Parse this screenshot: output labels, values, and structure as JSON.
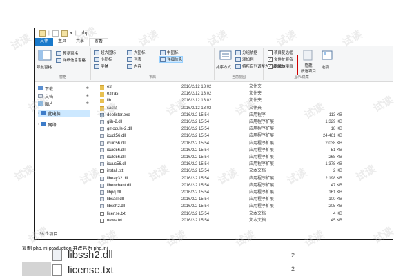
{
  "window": {
    "title": "php",
    "tabs": [
      "文件",
      "主页",
      "共享",
      "查看"
    ]
  },
  "ribbon": {
    "pane_group": {
      "nav_pane": "导航窗格",
      "preview_pane": "预览窗格",
      "details_pane": "详细信息窗格",
      "title": "窗格"
    },
    "layout_group": {
      "extra_large_icons": "超大图标",
      "large_icons": "大图标",
      "medium_icons": "中图标",
      "small_icons": "小图标",
      "list": "列表",
      "details": "详细信息",
      "tiles": "平铺",
      "content": "内容",
      "title": "布局"
    },
    "current_view_group": {
      "sort_by": "排序方式",
      "group_by": "分组依据",
      "add_columns": "添加列",
      "size_all_columns": "将所有列调整为合适的大小",
      "title": "当前视图"
    },
    "show_hide_group": {
      "item_checkboxes": "项目复选框",
      "file_extensions": "文件扩展名",
      "hidden_items": "隐藏的项目",
      "hide_selected": "隐藏",
      "hide_selected_2": "所选项目",
      "options": "选项",
      "title": "显示/隐藏",
      "item_checkboxes_checked": false,
      "file_extensions_checked": true,
      "hidden_items_checked": true
    }
  },
  "nav": {
    "items": [
      {
        "label": "下载",
        "icon": "download-icon",
        "pinned": true
      },
      {
        "label": "文档",
        "icon": "documents-icon",
        "pinned": true
      },
      {
        "label": "图片",
        "icon": "pictures-icon",
        "pinned": true
      },
      {
        "label": "此电脑",
        "icon": "computer-icon",
        "pinned": false
      },
      {
        "label": "网络",
        "icon": "network-icon",
        "pinned": false
      }
    ]
  },
  "files": [
    {
      "name": "ext",
      "date": "2016/2/12 13:02",
      "type": "文件夹",
      "size": "",
      "kind": "folder"
    },
    {
      "name": "extras",
      "date": "2016/2/12 13:02",
      "type": "文件夹",
      "size": "",
      "kind": "folder"
    },
    {
      "name": "lib",
      "date": "2016/2/12 13:02",
      "type": "文件夹",
      "size": "",
      "kind": "folder"
    },
    {
      "name": "sasl2",
      "date": "2016/2/12 13:02",
      "type": "文件夹",
      "size": "",
      "kind": "folder"
    },
    {
      "name": "deplister.exe",
      "date": "2016/2/2 15:54",
      "type": "应用程序",
      "size": "113 KB",
      "kind": "exe"
    },
    {
      "name": "glib-2.dll",
      "date": "2016/2/2 15:54",
      "type": "应用程序扩展",
      "size": "1,329 KB",
      "kind": "dll"
    },
    {
      "name": "gmodule-2.dll",
      "date": "2016/2/2 15:54",
      "type": "应用程序扩展",
      "size": "18 KB",
      "kind": "dll"
    },
    {
      "name": "icudt56.dll",
      "date": "2016/2/2 15:54",
      "type": "应用程序扩展",
      "size": "24,461 KB",
      "kind": "dll"
    },
    {
      "name": "icuin56.dll",
      "date": "2016/2/2 15:54",
      "type": "应用程序扩展",
      "size": "2,038 KB",
      "kind": "dll"
    },
    {
      "name": "icuio56.dll",
      "date": "2016/2/2 15:54",
      "type": "应用程序扩展",
      "size": "51 KB",
      "kind": "dll"
    },
    {
      "name": "icule56.dll",
      "date": "2016/2/2 15:54",
      "type": "应用程序扩展",
      "size": "268 KB",
      "kind": "dll"
    },
    {
      "name": "icuuc56.dll",
      "date": "2016/2/2 15:54",
      "type": "应用程序扩展",
      "size": "1,378 KB",
      "kind": "dll"
    },
    {
      "name": "install.txt",
      "date": "2016/2/2 15:54",
      "type": "文本文档",
      "size": "2 KB",
      "kind": "txt"
    },
    {
      "name": "libeay32.dll",
      "date": "2016/2/2 15:54",
      "type": "应用程序扩展",
      "size": "2,198 KB",
      "kind": "dll"
    },
    {
      "name": "libenchant.dll",
      "date": "2016/2/2 15:54",
      "type": "应用程序扩展",
      "size": "47 KB",
      "kind": "dll"
    },
    {
      "name": "libpq.dll",
      "date": "2016/2/2 15:54",
      "type": "应用程序扩展",
      "size": "161 KB",
      "kind": "dll"
    },
    {
      "name": "libsasl.dll",
      "date": "2016/2/2 15:54",
      "type": "应用程序扩展",
      "size": "100 KB",
      "kind": "dll"
    },
    {
      "name": "libssh2.dll",
      "date": "2016/2/2 15:54",
      "type": "应用程序扩展",
      "size": "205 KB",
      "kind": "dll"
    },
    {
      "name": "license.txt",
      "date": "2016/2/2 15:54",
      "type": "文本文档",
      "size": "4 KB",
      "kind": "txt"
    },
    {
      "name": "news.txt",
      "date": "2016/2/2 15:54",
      "type": "文本文档",
      "size": "45 KB",
      "kind": "txt"
    }
  ],
  "status": {
    "item_count": "36 个项目"
  },
  "caption": "复制 php.ini-production 并改名为 php.ini",
  "below": {
    "line1": "libssh2.dll",
    "line2": "license.txt",
    "mark1": "2",
    "mark2": "2"
  },
  "watermark": "试读",
  "colors": {
    "file_tab": "#1979ca",
    "highlight_box": "#d00000",
    "selection": "#cce8ff",
    "folder": "#e8c152"
  }
}
